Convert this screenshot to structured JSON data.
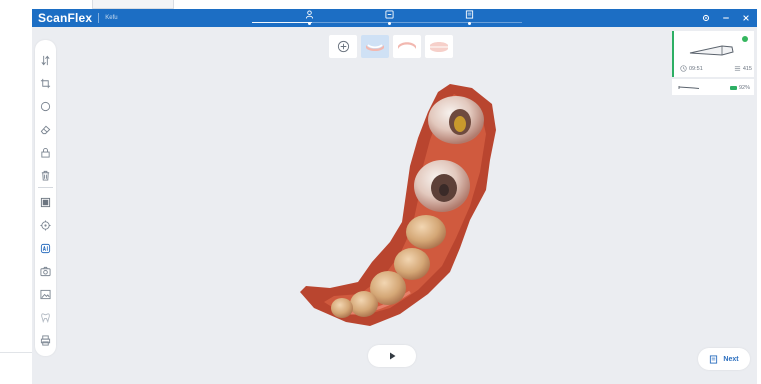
{
  "app": {
    "brand": "ScanFlex",
    "subtitle": "Kefu",
    "accent_color": "#1c6ec4",
    "status_color": "#2daf64"
  },
  "stepper": {
    "steps": [
      {
        "icon": "person-icon",
        "state": "done"
      },
      {
        "icon": "scan-frame-icon",
        "state": "current"
      },
      {
        "icon": "report-icon",
        "state": "pending"
      }
    ]
  },
  "window_controls": [
    "settings-icon",
    "minimize-icon",
    "close-icon"
  ],
  "sidebar": {
    "tools": [
      "swap-jaw-icon",
      "crop-icon",
      "circle-select-icon",
      "eraser-icon",
      "lock-icon",
      "trash-icon",
      "texture-toggle-icon",
      "target-icon",
      "ai-icon",
      "snapshot-icon",
      "image-icon",
      "tooth-icon",
      "print-icon"
    ]
  },
  "view_toolbar": {
    "buttons": [
      {
        "icon": "add-icon",
        "active": false
      },
      {
        "icon": "lower-jaw-icon",
        "active": true
      },
      {
        "icon": "upper-jaw-icon",
        "active": false
      },
      {
        "icon": "bite-icon",
        "active": false
      }
    ]
  },
  "scanner_panel": {
    "time": "09:51",
    "frames": "415",
    "battery": "92%"
  },
  "next_button": {
    "label": "Next"
  }
}
